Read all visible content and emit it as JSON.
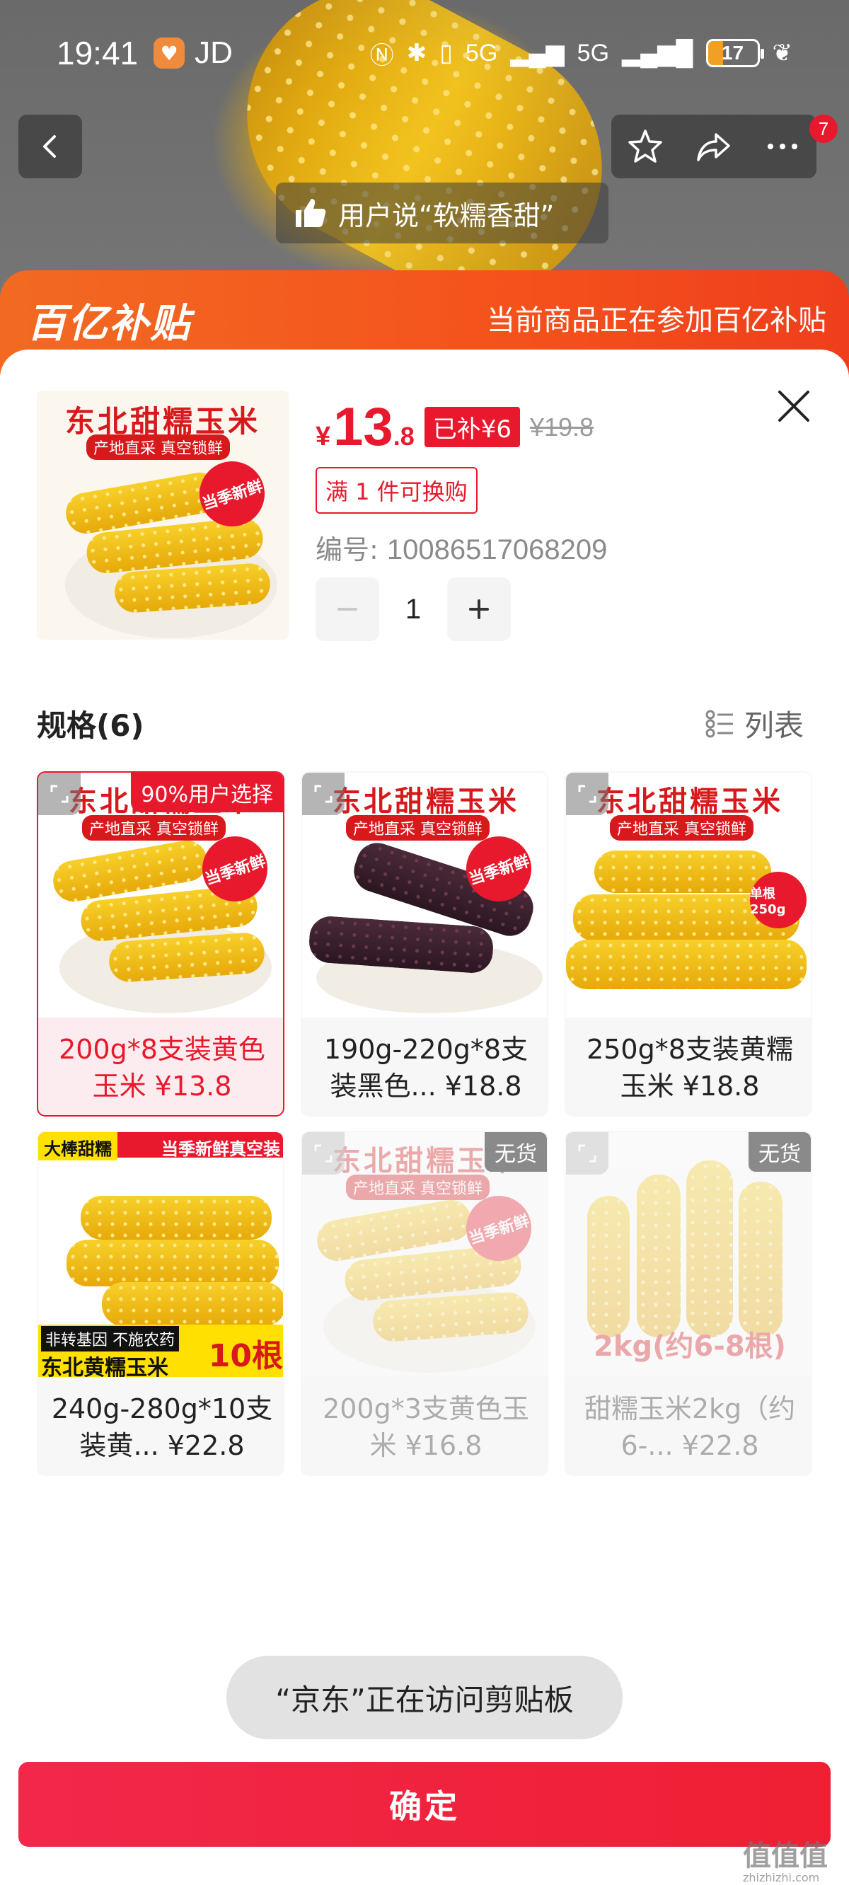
{
  "status_bar": {
    "time": "19:41",
    "app_label": "JD",
    "battery": "17",
    "network_a": "5G",
    "network_b": "5G"
  },
  "nav": {
    "badge_count": "7",
    "review_text": "用户说“软糯香甜”"
  },
  "subsidy": {
    "logo_text": "百亿补贴",
    "banner_text": "当前商品正在参加百亿补贴"
  },
  "product": {
    "thumb_title": "东北甜糯玉米",
    "thumb_subtitle": "产地直采 真空锁鲜",
    "fresh_badge": "当季新鲜",
    "currency": "¥",
    "price_int": "13",
    "price_dec": ".8",
    "subsidy_tag": "已补¥6",
    "original_price": "¥19.8",
    "swap_tag": "满 1 件可换购",
    "code_label": "编号:",
    "code_value": "10086517068209",
    "quantity": "1"
  },
  "specs": {
    "title": "规格(6)",
    "list_label": "列表",
    "items": [
      {
        "name": "200g*8支装黄色玉米 ¥13.8",
        "ribbon": "90%用户选择",
        "img_title": "东北甜糯玉米",
        "img_sub": "产地直采 真空锁鲜",
        "badge": "当季新鲜"
      },
      {
        "name": "190g-220g*8支装黑色... ¥18.8",
        "img_title": "东北甜糯玉米",
        "img_sub": "产地直采 真空锁鲜",
        "badge": "当季新鲜"
      },
      {
        "name": "250g*8支装黄糯玉米 ¥18.8",
        "img_title": "东北甜糯玉米",
        "img_sub": "产地直采 真空锁鲜",
        "badge": "单根250g"
      },
      {
        "name": "240g-280g*10支装黄... ¥22.8",
        "img_top_left": "大棒甜糯",
        "img_top_right": "当季新鲜真空装",
        "img_bottom_a": "非转基因 不施农药",
        "img_bottom_b": "东北黄糯玉米",
        "img_count": "10根"
      },
      {
        "name": "200g*3支黄色玉米 ¥16.8",
        "soldout": "无货",
        "img_title": "东北甜糯玉米",
        "img_sub": "产地直采 真空锁鲜",
        "badge": "当季新鲜"
      },
      {
        "name": "甜糯玉米2kg（约6-... ¥22.8",
        "soldout": "无货",
        "img_label": "2kg(约6-8根)"
      }
    ]
  },
  "toast": "“京东”正在访问剪贴板",
  "confirm_label": "确定",
  "watermark": {
    "main": "值值值",
    "sub": "zhizhizhi.com"
  },
  "colors": {
    "brand_red": "#e8192c",
    "subsidy_orange": "#f4521c"
  }
}
